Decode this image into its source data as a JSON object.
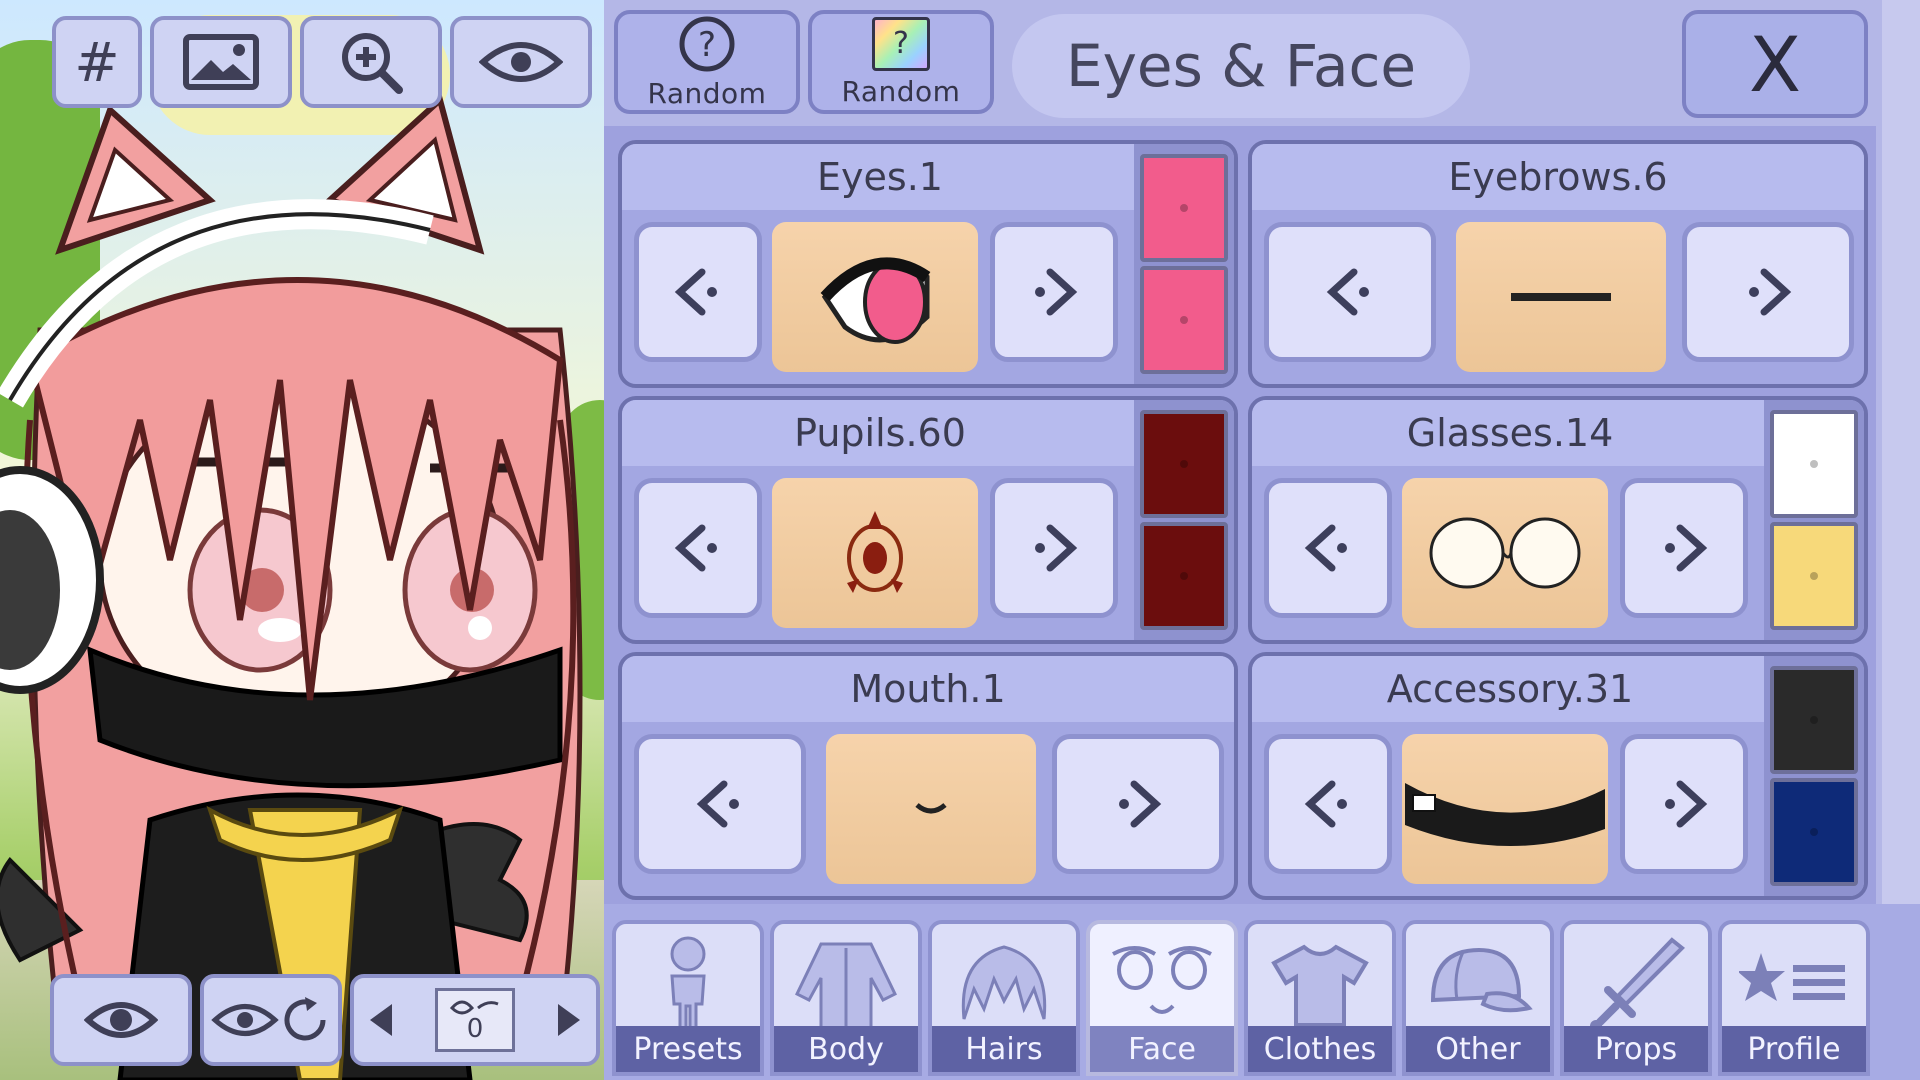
{
  "toolbar_top": {
    "grid_label": "#"
  },
  "toolbar_bottom": {
    "counter_value": "0"
  },
  "header": {
    "random_label_1": "Random",
    "random_label_2": "Random",
    "random_icon_1": "?",
    "random_icon_2": "?",
    "title": "Eyes & Face",
    "close_label": "X"
  },
  "cards": {
    "eyes": {
      "title": "Eyes.1",
      "colors": [
        "#f25c8c",
        "#f25c8c"
      ]
    },
    "eyebrows": {
      "title": "Eyebrows.6"
    },
    "pupils": {
      "title": "Pupils.60",
      "colors": [
        "#6b0d0d",
        "#6b0d0d"
      ]
    },
    "glasses": {
      "title": "Glasses.14",
      "colors": [
        "#ffffff",
        "#f7d97a"
      ]
    },
    "mouth": {
      "title": "Mouth.1"
    },
    "accessory": {
      "title": "Accessory.31",
      "colors": [
        "#2a2a2a",
        "#0e2a78"
      ]
    }
  },
  "tabs": [
    {
      "label": "Presets",
      "icon": "person-icon"
    },
    {
      "label": "Body",
      "icon": "jacket-icon"
    },
    {
      "label": "Hairs",
      "icon": "hair-icon"
    },
    {
      "label": "Face",
      "icon": "face-icon",
      "active": true
    },
    {
      "label": "Clothes",
      "icon": "shirt-icon"
    },
    {
      "label": "Other",
      "icon": "cap-icon"
    },
    {
      "label": "Props",
      "icon": "sword-icon"
    },
    {
      "label": "Profile",
      "icon": "star-list-icon"
    }
  ],
  "colors": {
    "panel": "#b4b7e7",
    "card": "#a3a7e2",
    "tab_label": "#5e62a4",
    "preview": "#f6d3ab"
  }
}
